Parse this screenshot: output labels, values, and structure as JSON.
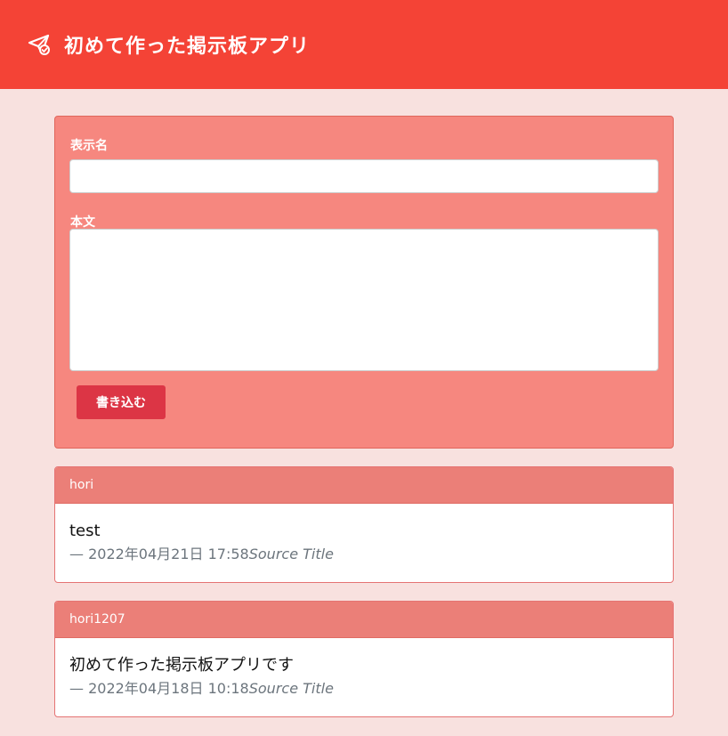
{
  "header": {
    "title": "初めて作った掲示板アプリ",
    "icon": "paper-plane-check-icon"
  },
  "form": {
    "name_label": "表示名",
    "name_value": "",
    "body_label": "本文",
    "body_value": "",
    "submit_label": "書き込む"
  },
  "posts": [
    {
      "author": "hori",
      "text": "test",
      "meta_prefix": "— 2022年04月21日 17:58",
      "source": "Source Title"
    },
    {
      "author": "hori1207",
      "text": "初めて作った掲示板アプリです",
      "meta_prefix": "— 2022年04月18日 10:18",
      "source": "Source Title"
    }
  ],
  "colors": {
    "header": "#f44336",
    "background": "#f8e1df",
    "form_card": "#f6877f",
    "post_header": "#eb7f78",
    "submit_button": "#dc3545"
  }
}
